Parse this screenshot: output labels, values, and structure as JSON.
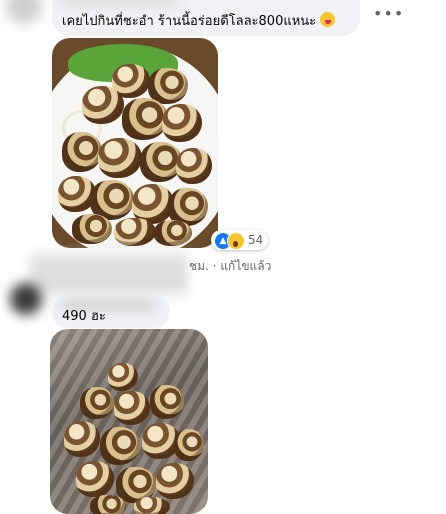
{
  "comment1": {
    "text": "เคยไปกินที่ชะอำ ร้านนี้อร่อยดีโลละ800แหนะ",
    "emoji": "face-with-tongue-icon"
  },
  "reactions": {
    "icons": [
      "like-icon",
      "wow-icon"
    ],
    "count": "54"
  },
  "meta": {
    "text": "ชม. · แก้ไขแล้ว"
  },
  "comment2": {
    "text": "490 ฮะ"
  },
  "colors": {
    "bubble": "#f0f2f5",
    "secondary_text": "#65676b",
    "like_blue": "#1877f2"
  }
}
